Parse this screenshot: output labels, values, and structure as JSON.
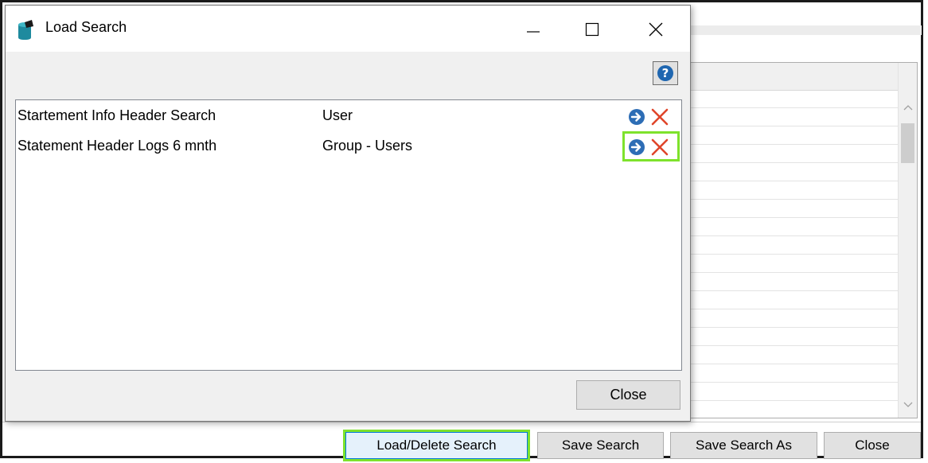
{
  "dialog": {
    "title": "Load Search",
    "rows": [
      {
        "name": "Startement Info Header Search",
        "owner": "User"
      },
      {
        "name": "Statement Header Logs 6 mnth",
        "owner": "Group - Users"
      }
    ],
    "close_label": "Close"
  },
  "background": {
    "buttons": {
      "load_delete": "Load/Delete Search",
      "save": "Save Search",
      "save_as": "Save Search As",
      "close": "Close"
    }
  },
  "icons": {
    "app": "database-icon",
    "help": "question-mark-icon",
    "load": "arrow-right-circle-icon",
    "delete": "red-x-icon"
  },
  "colors": {
    "highlight": "#7ee22c",
    "load_icon": "#2d6db5",
    "delete_icon": "#e0452a",
    "app_icon": "#1e8a9e",
    "help_icon": "#1f66b0"
  }
}
